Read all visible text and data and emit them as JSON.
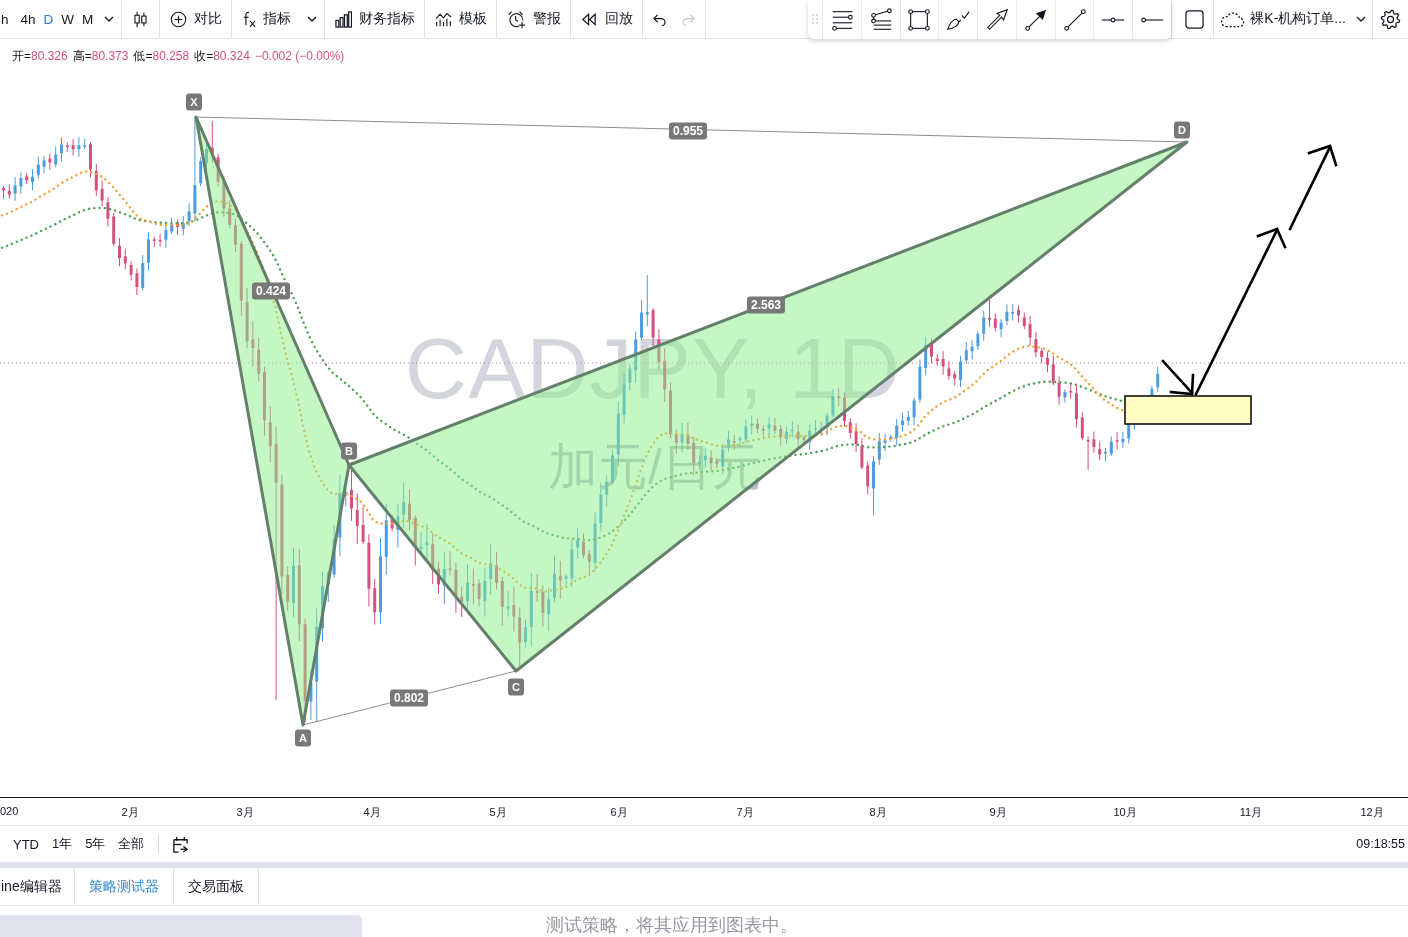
{
  "toolbar": {
    "intervals": [
      {
        "label": "h",
        "selected": false
      },
      {
        "label": "4h",
        "selected": false
      },
      {
        "label": "D",
        "selected": true
      },
      {
        "label": "W",
        "selected": false
      },
      {
        "label": "M",
        "selected": false
      }
    ],
    "buttons": [
      {
        "kind": "compare",
        "label": "对比"
      },
      {
        "kind": "indicators",
        "label": "指标"
      },
      {
        "kind": "financials",
        "label": "财务指标"
      },
      {
        "kind": "templates",
        "label": "模板"
      },
      {
        "kind": "alerts",
        "label": "警报"
      },
      {
        "kind": "replay",
        "label": "回放"
      }
    ],
    "undo": {
      "disabled": false
    },
    "redo": {
      "disabled": true
    }
  },
  "layout_menu": {
    "name": "裸K-机构订单..."
  },
  "legend": {
    "values": [
      {
        "label": "开=",
        "value": "80.326"
      },
      {
        "label": "高=",
        "value": "80.373"
      },
      {
        "label": "低=",
        "value": "80.258"
      },
      {
        "label": "收=",
        "value": "80.324"
      }
    ],
    "change": "−0.002 (−0.00%)"
  },
  "watermark": {
    "symbol": "CADJPY, 1D",
    "description": "加元/日元"
  },
  "pattern": {
    "points": [
      "X",
      "A",
      "B",
      "C",
      "D"
    ],
    "ratios": [
      "0.955",
      "0.424",
      "2.563",
      "0.802"
    ]
  },
  "time_axis": [
    "020",
    "2月",
    "3月",
    "4月",
    "5月",
    "6月",
    "7月",
    "8月",
    "9月",
    "10月",
    "11月",
    "12月"
  ],
  "range_bar": {
    "ranges": [
      "YTD",
      "1年",
      "5年",
      "全部"
    ],
    "clock": "09:18:55"
  },
  "bottom_panel": {
    "tabs": [
      {
        "label": "ine编辑器",
        "selected": false
      },
      {
        "label": "策略测试器",
        "selected": true
      },
      {
        "label": "交易面板",
        "selected": false
      }
    ],
    "message": "测试策略，将其应用到图表中。"
  }
}
